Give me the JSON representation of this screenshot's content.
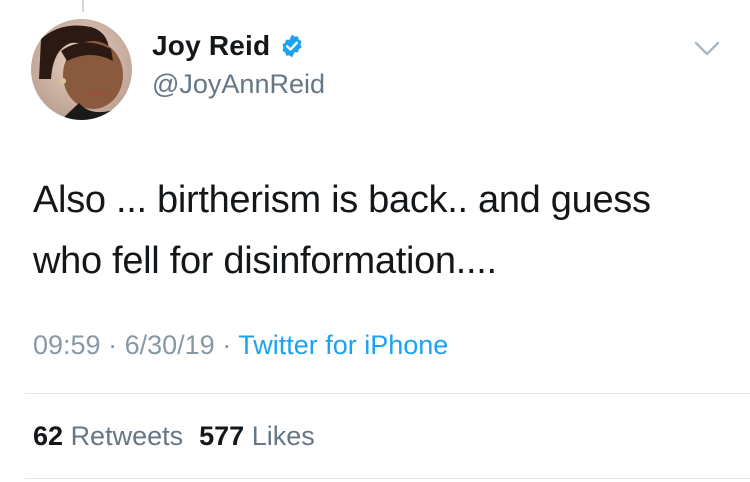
{
  "author": {
    "display_name": "Joy Reid",
    "handle": "@JoyAnnReid",
    "verified": true,
    "avatar_icon": "profile-photo"
  },
  "tweet": {
    "text_line1": "Also ... birtherism is back.. and guess",
    "text_line2": "who fell for disinformation....",
    "time": "09:59",
    "date": "6/30/19",
    "separator": "·",
    "source": "Twitter for iPhone"
  },
  "stats": {
    "retweets_count": "62",
    "retweets_label": "Retweets",
    "likes_count": "577",
    "likes_label": "Likes"
  },
  "colors": {
    "text": "#14171a",
    "secondary": "#657786",
    "link": "#1da1f2",
    "verified": "#1da1f2"
  }
}
